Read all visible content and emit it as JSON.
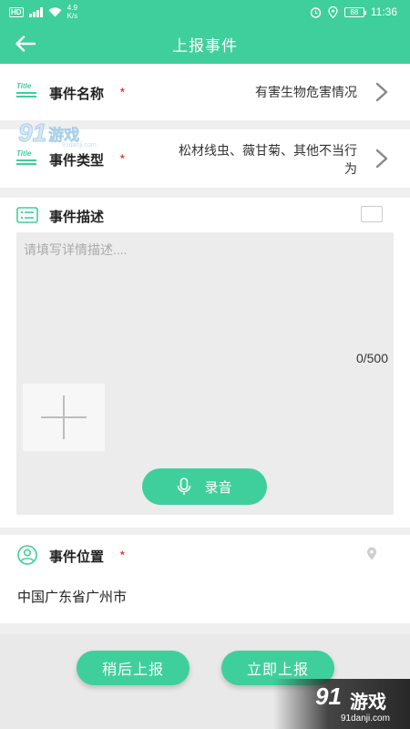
{
  "status_bar": {
    "hd": "HD",
    "net_speed_value": "4.9",
    "net_speed_unit": "K/s",
    "battery": "88",
    "time": "11:36"
  },
  "header": {
    "title": "上报事件"
  },
  "event_name": {
    "label": "事件名称",
    "value": "有害生物危害情况"
  },
  "event_type": {
    "label": "事件类型",
    "value_line1": "松材线虫、薇甘菊、其他不当行",
    "value_line2": "为"
  },
  "icon_title_text": "Title",
  "description": {
    "label": "事件描述",
    "placeholder": "请填写详情描述....",
    "counter": "0/500",
    "record_label": "录音"
  },
  "location": {
    "label": "事件位置",
    "value": "中国广东省广州市"
  },
  "required_mark": "*",
  "actions": {
    "later": "稍后上报",
    "now": "立即上报"
  },
  "watermark": {
    "brand_num": "91",
    "brand_name": "游戏",
    "url": "91danji.com"
  },
  "colors": {
    "accent": "#3fcf9c",
    "required": "#e53935"
  }
}
